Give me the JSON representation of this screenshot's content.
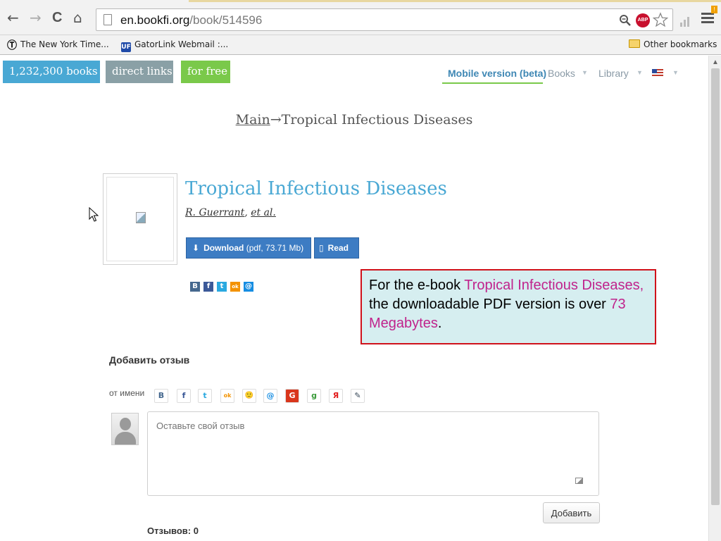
{
  "browser": {
    "nav": {
      "back": "←",
      "forward": "→",
      "reload": "C",
      "home": "⌂"
    },
    "url_host": "en.bookfi.org",
    "url_path": "/book/514596",
    "icons": {
      "zoom": "zoom-icon",
      "adblock": "adblock-icon",
      "star": "star-icon",
      "menu": "menu-icon"
    },
    "abp_label": "ABP",
    "bookmarks": [
      {
        "label": "The New York Time..."
      },
      {
        "label": "GatorLink Webmail :..."
      }
    ],
    "bookmark_icons": {
      "nyt": "Ⓣ",
      "uf": "UF"
    },
    "other_bookmarks": "Other bookmarks"
  },
  "site": {
    "badges": {
      "books": "1,232,300 books",
      "direct": "direct links",
      "free": "for free"
    },
    "nav": {
      "mobile": "Mobile version (beta)",
      "books": "Books",
      "library": "Library"
    },
    "breadcrumb": {
      "main": "Main",
      "arrow": "→",
      "current": "Tropical Infectious Diseases"
    }
  },
  "book": {
    "title": "Tropical Infectious Diseases",
    "author": "R. Guerrant",
    "sep": ", ",
    "etal": "et al.",
    "download_label": "Download",
    "download_meta": "(pdf, 73.71 Mb)",
    "read_label": "Read",
    "share": [
      "В",
      "f",
      "t",
      "ok",
      "@"
    ]
  },
  "callout": {
    "p1": "For the e-book ",
    "h1": "Tropical Infectious Diseases,",
    "p2": " the downloadable PDF version is over ",
    "h2": "73 Megabytes",
    "p3": "."
  },
  "reviews": {
    "heading": "Добавить отзыв",
    "from_name": "от имени",
    "social": [
      "В",
      "f",
      "t",
      "ok",
      "🙂",
      "@",
      "G",
      "g",
      "Я",
      "✎"
    ],
    "placeholder": "Оставьте свой отзыв",
    "add_button": "Добавить",
    "count_label": "Отзывов: 0"
  },
  "colors": {
    "accent": "#49a8d4",
    "highlight": "#c0238c",
    "callout_border": "#d0121b"
  }
}
